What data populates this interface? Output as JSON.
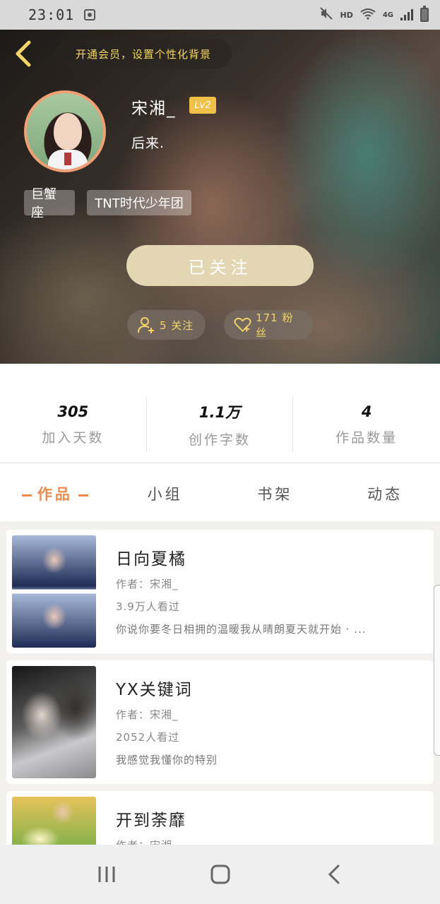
{
  "status_bar": {
    "time": "23:01",
    "network_hd": "HD",
    "network_type": "4G"
  },
  "header": {
    "vip_banner": "开通会员，设置个性化背景",
    "user_name": "宋湘_",
    "level": "Lv2",
    "bio": "后来.",
    "tags": [
      "巨蟹座",
      "TNT时代少年团"
    ],
    "follow_button": "已关注",
    "following_label": "5 关注",
    "fans_label": "171 粉丝"
  },
  "stats": [
    {
      "value": "305",
      "label": "加入天数"
    },
    {
      "value": "1.1万",
      "label": "创作字数"
    },
    {
      "value": "4",
      "label": "作品数量"
    }
  ],
  "tabs": [
    {
      "label": "作品",
      "active": true
    },
    {
      "label": "小组",
      "active": false
    },
    {
      "label": "书架",
      "active": false
    },
    {
      "label": "动态",
      "active": false
    }
  ],
  "works": [
    {
      "title": "日向夏橘",
      "author": "作者：宋湘_",
      "views": "3.9万人看过",
      "desc": "你说你要冬日相拥的温暖我从晴朗夏天就开始 · ..."
    },
    {
      "title": "YX关键词",
      "author": "作者：宋湘_",
      "views": "2052人看过",
      "desc": "我感觉我懂你的特别"
    },
    {
      "title": "开到荼靡",
      "author": "作者：宋湘",
      "views": "",
      "desc": ""
    }
  ],
  "colors": {
    "accent": "#e98c4f",
    "vip_gold": "#f3d36b",
    "follow_button_bg": "#e2d6b3",
    "level_badge": "#f0c048"
  },
  "icons": [
    "back-arrow-icon",
    "person-add-icon",
    "heart-plus-icon",
    "recent-apps-icon",
    "home-icon",
    "nav-back-icon"
  ]
}
